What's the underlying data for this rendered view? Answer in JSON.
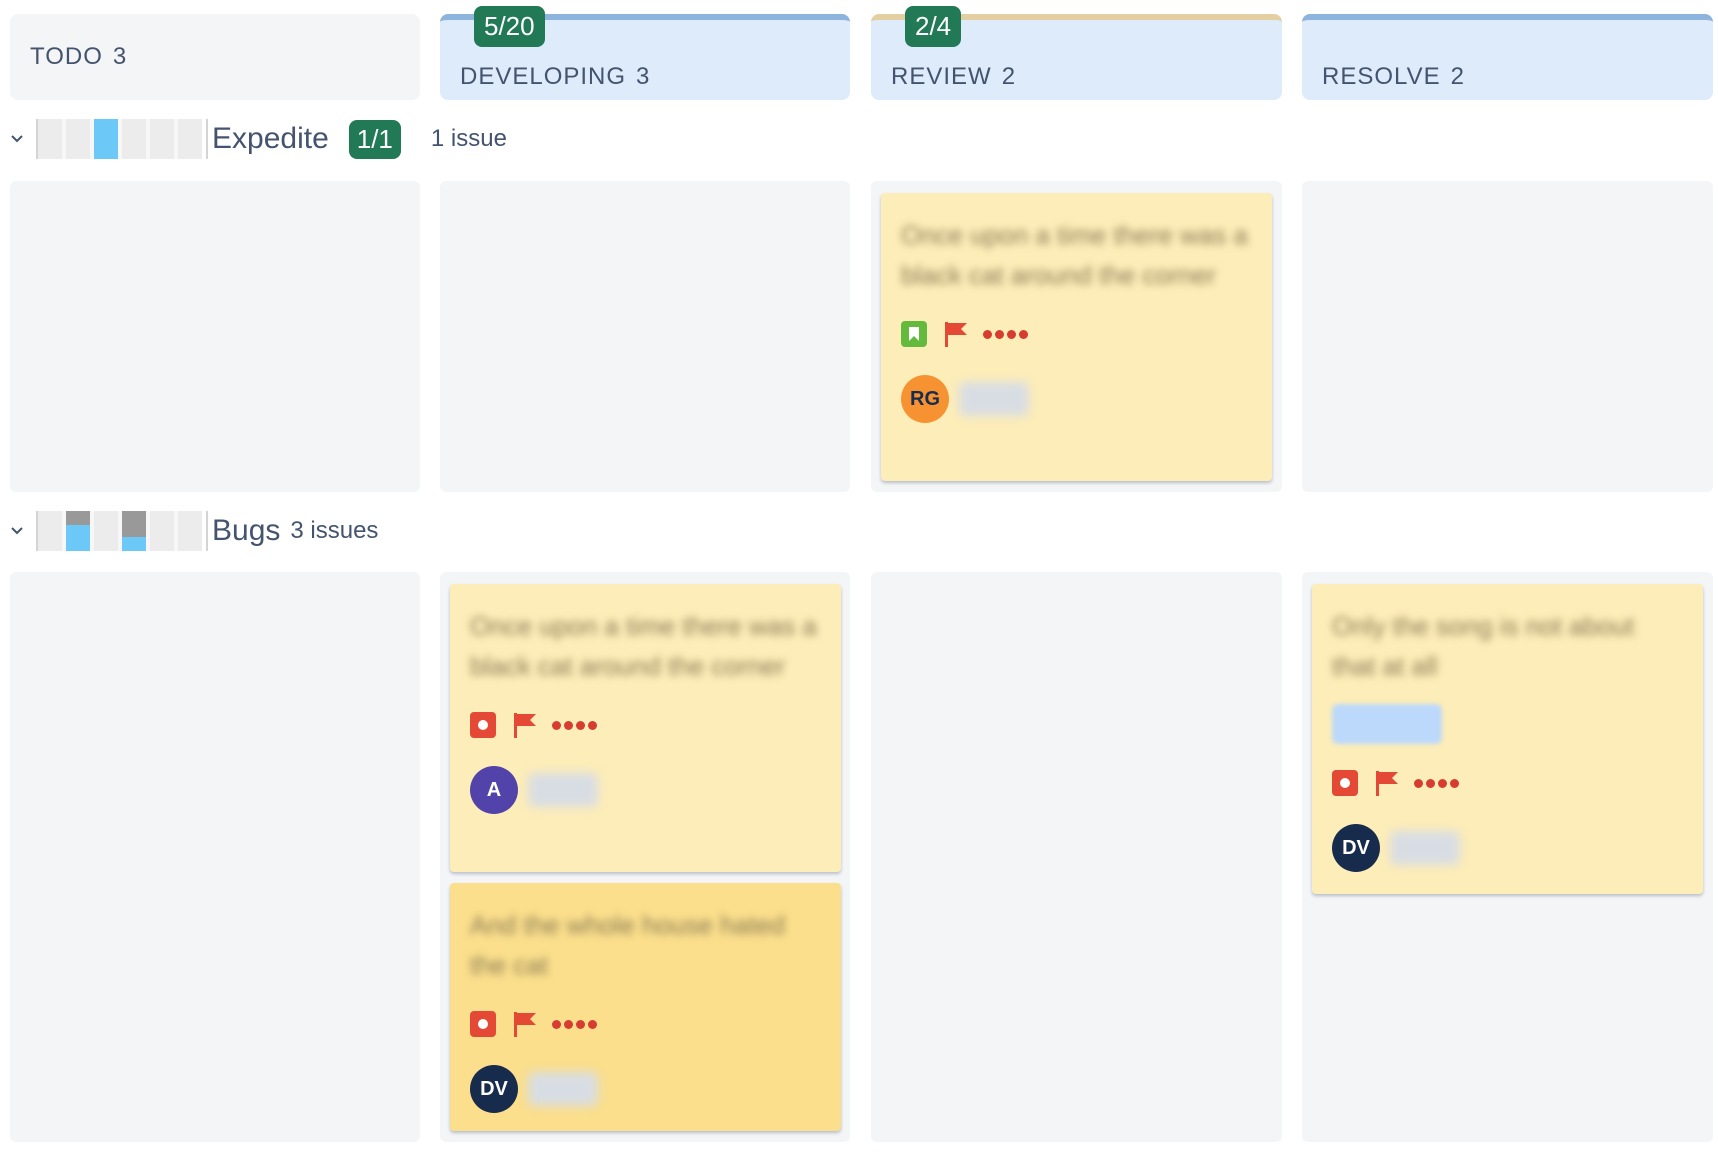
{
  "columns": [
    {
      "name": "TODO",
      "count": "3",
      "wip": "",
      "accent": "none"
    },
    {
      "name": "DEVELOPING",
      "count": "3",
      "wip": "5/20",
      "accent": "#8cb4dc"
    },
    {
      "name": "REVIEW",
      "count": "2",
      "wip": "2/4",
      "accent": "#e4cfa2"
    },
    {
      "name": "RESOLVE",
      "count": "2",
      "wip": "",
      "accent": "#8cb4dc"
    }
  ],
  "lanes": [
    {
      "title": "Expedite",
      "wip": "1/1",
      "count": "1 issue"
    },
    {
      "title": "Bugs",
      "wip": "",
      "count": "3 issues"
    }
  ],
  "cards": [
    {
      "title": "Once upon a time there was a black cat around the corner",
      "type": "story",
      "avatar": "RG",
      "avatar_color": "#f79232",
      "avatar_text_color": "#172b4d",
      "priority": "highest"
    },
    {
      "title": "Once upon a time there was a black cat around the corner",
      "type": "bug",
      "avatar": "A",
      "avatar_color": "#5243aa",
      "avatar_text_color": "#ffffff",
      "priority": "highest"
    },
    {
      "title": "And the whole house hated the cat",
      "type": "bug",
      "avatar": "DV",
      "avatar_color": "#172b4d",
      "avatar_text_color": "#ffffff",
      "priority": "highest"
    },
    {
      "title": "Only the song is not about that at all",
      "type": "bug",
      "avatar": "DV",
      "avatar_color": "#172b4d",
      "avatar_text_color": "#ffffff",
      "priority": "highest"
    }
  ],
  "colors": {
    "wip_badge": "#217a55",
    "card_bg": "#fdedb8",
    "card_bg_alt": "#fbdf8c",
    "flag": "#e34935",
    "progress_blue": "#6cc8f7"
  },
  "icons": [
    "chevron-down-icon",
    "story-icon",
    "bug-icon",
    "flag-icon",
    "priority-icon"
  ]
}
